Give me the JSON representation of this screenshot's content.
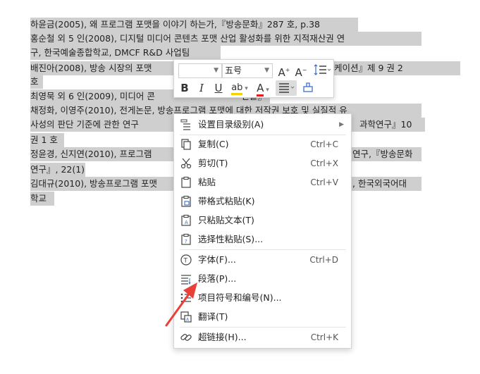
{
  "document": {
    "lines": [
      "하윤금(2005), 왜 프로그램 포맷을 이야기 하는가,『방송문화』287 호, p.38",
      "홍순철 외 5 인(2008), 디지털 미디어 콘텐츠 포맷 산업 활성화를 위한 지적재산권 연",
      "구,   한국예술종합학교, DMCF R&D 사업팀",
      "배진아(2008), 방송 시장의 포맷",
      "호",
      "최영묵 외 6 인(2009), 미디어 콘",
      "채정화, 이영주(2010), 전게논문, 방송프로그램 포맷에 대한 저작권 보호 및 실질적 유",
      "사성의 판단 기준에 관한 연구",
      "권 1 호",
      "정윤경, 신지연(2010), 프로그램",
      "연구』, 22(1)",
      "김대규(2010), 방송프로그램 포맷",
      "학교"
    ],
    "right_fragments": {
      "l4": "케이션』제 9 권  2",
      "l6": "『한울』",
      "l8": "과학연구』10",
      "l10": "연구,『방송문화",
      "l12": ", 한국외국어대"
    }
  },
  "mini_toolbar": {
    "font_name": "",
    "font_size": "五号",
    "grow_font": "A",
    "shrink_font": "A",
    "line_spacing_icon": "line-spacing-icon",
    "bold": "B",
    "italic": "I",
    "underline": "U",
    "highlight": "ab",
    "font_color_letter": "A",
    "font_color": "#e02020",
    "highlight_color": "#f5d100"
  },
  "context_menu": {
    "items": [
      {
        "label": "设置目录级别(A)",
        "shortcut": "",
        "submenu": true
      },
      {
        "label": "复制(C)",
        "shortcut": "Ctrl+C"
      },
      {
        "label": "剪切(T)",
        "shortcut": "Ctrl+X"
      },
      {
        "label": "粘贴",
        "shortcut": "Ctrl+V"
      },
      {
        "label": "带格式粘贴(K)",
        "shortcut": ""
      },
      {
        "label": "只粘贴文本(T)",
        "shortcut": ""
      },
      {
        "label": "选择性粘贴(S)...",
        "shortcut": ""
      },
      {
        "label": "字体(F)...",
        "shortcut": "Ctrl+D"
      },
      {
        "label": "段落(P)...",
        "shortcut": ""
      },
      {
        "label": "项目符号和编号(N)...",
        "shortcut": ""
      },
      {
        "label": "翻译(T)",
        "shortcut": ""
      },
      {
        "label": "超链接(H)...",
        "shortcut": "Ctrl+K"
      }
    ]
  },
  "colors": {
    "selection": "#cfcfcf",
    "annotation_arrow": "#e8413a"
  }
}
